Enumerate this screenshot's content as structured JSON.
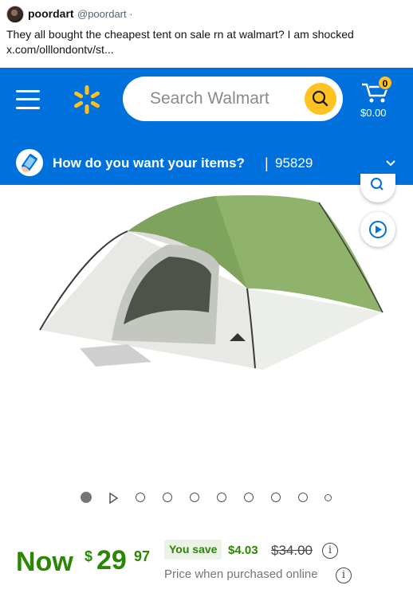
{
  "tweet": {
    "author_name": "poordart",
    "author_handle": "@poordart ·",
    "text_line1": "They all bought the cheapest tent on sale rn at walmart? I am shocked",
    "text_line2": "x.com/olllondontv/st..."
  },
  "header": {
    "menu_icon": "hamburger-icon",
    "logo_icon": "walmart-spark-icon",
    "search_placeholder": "Search Walmart",
    "search_icon": "search-icon",
    "cart_icon": "cart-icon",
    "cart_count": "0",
    "cart_total": "$0.00",
    "brand_color": "#0071dc",
    "accent_color": "#ffc220"
  },
  "delivery": {
    "prompt": "How do you want your items?",
    "separator": "|",
    "zip": "95829"
  },
  "product": {
    "image_alt": "Green and gray dome tent",
    "carousel_count": 10,
    "carousel_active": 0
  },
  "price": {
    "now_label": "Now",
    "currency": "$",
    "dollars": "29",
    "cents": "97",
    "you_save_label": "You save",
    "save_amount": "$4.03",
    "was_price": "$34.00",
    "info_glyph": "i",
    "online_note": "Price when purchased online",
    "price_color": "#2a8703"
  }
}
